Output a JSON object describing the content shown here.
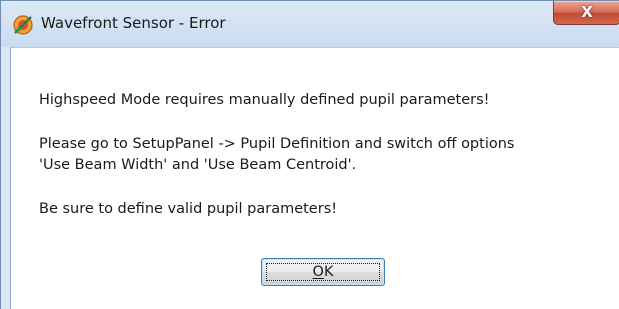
{
  "window": {
    "title": "Wavefront Sensor - Error",
    "close_glyph": "X",
    "icon": "app-icon"
  },
  "dialog": {
    "line1": "Highspeed Mode requires manually defined pupil parameters!",
    "line2": "Please go to SetupPanel -> Pupil Definition and switch off options",
    "line3": "'Use Beam Width' and 'Use Beam Centroid'.",
    "line4": "Be sure to define valid pupil parameters!"
  },
  "buttons": {
    "ok_mnemonic": "O",
    "ok_rest": "K"
  },
  "colors": {
    "close_button": "#d0604a",
    "button_focus": "#3c7fb1",
    "frame": "#dae7f5"
  }
}
